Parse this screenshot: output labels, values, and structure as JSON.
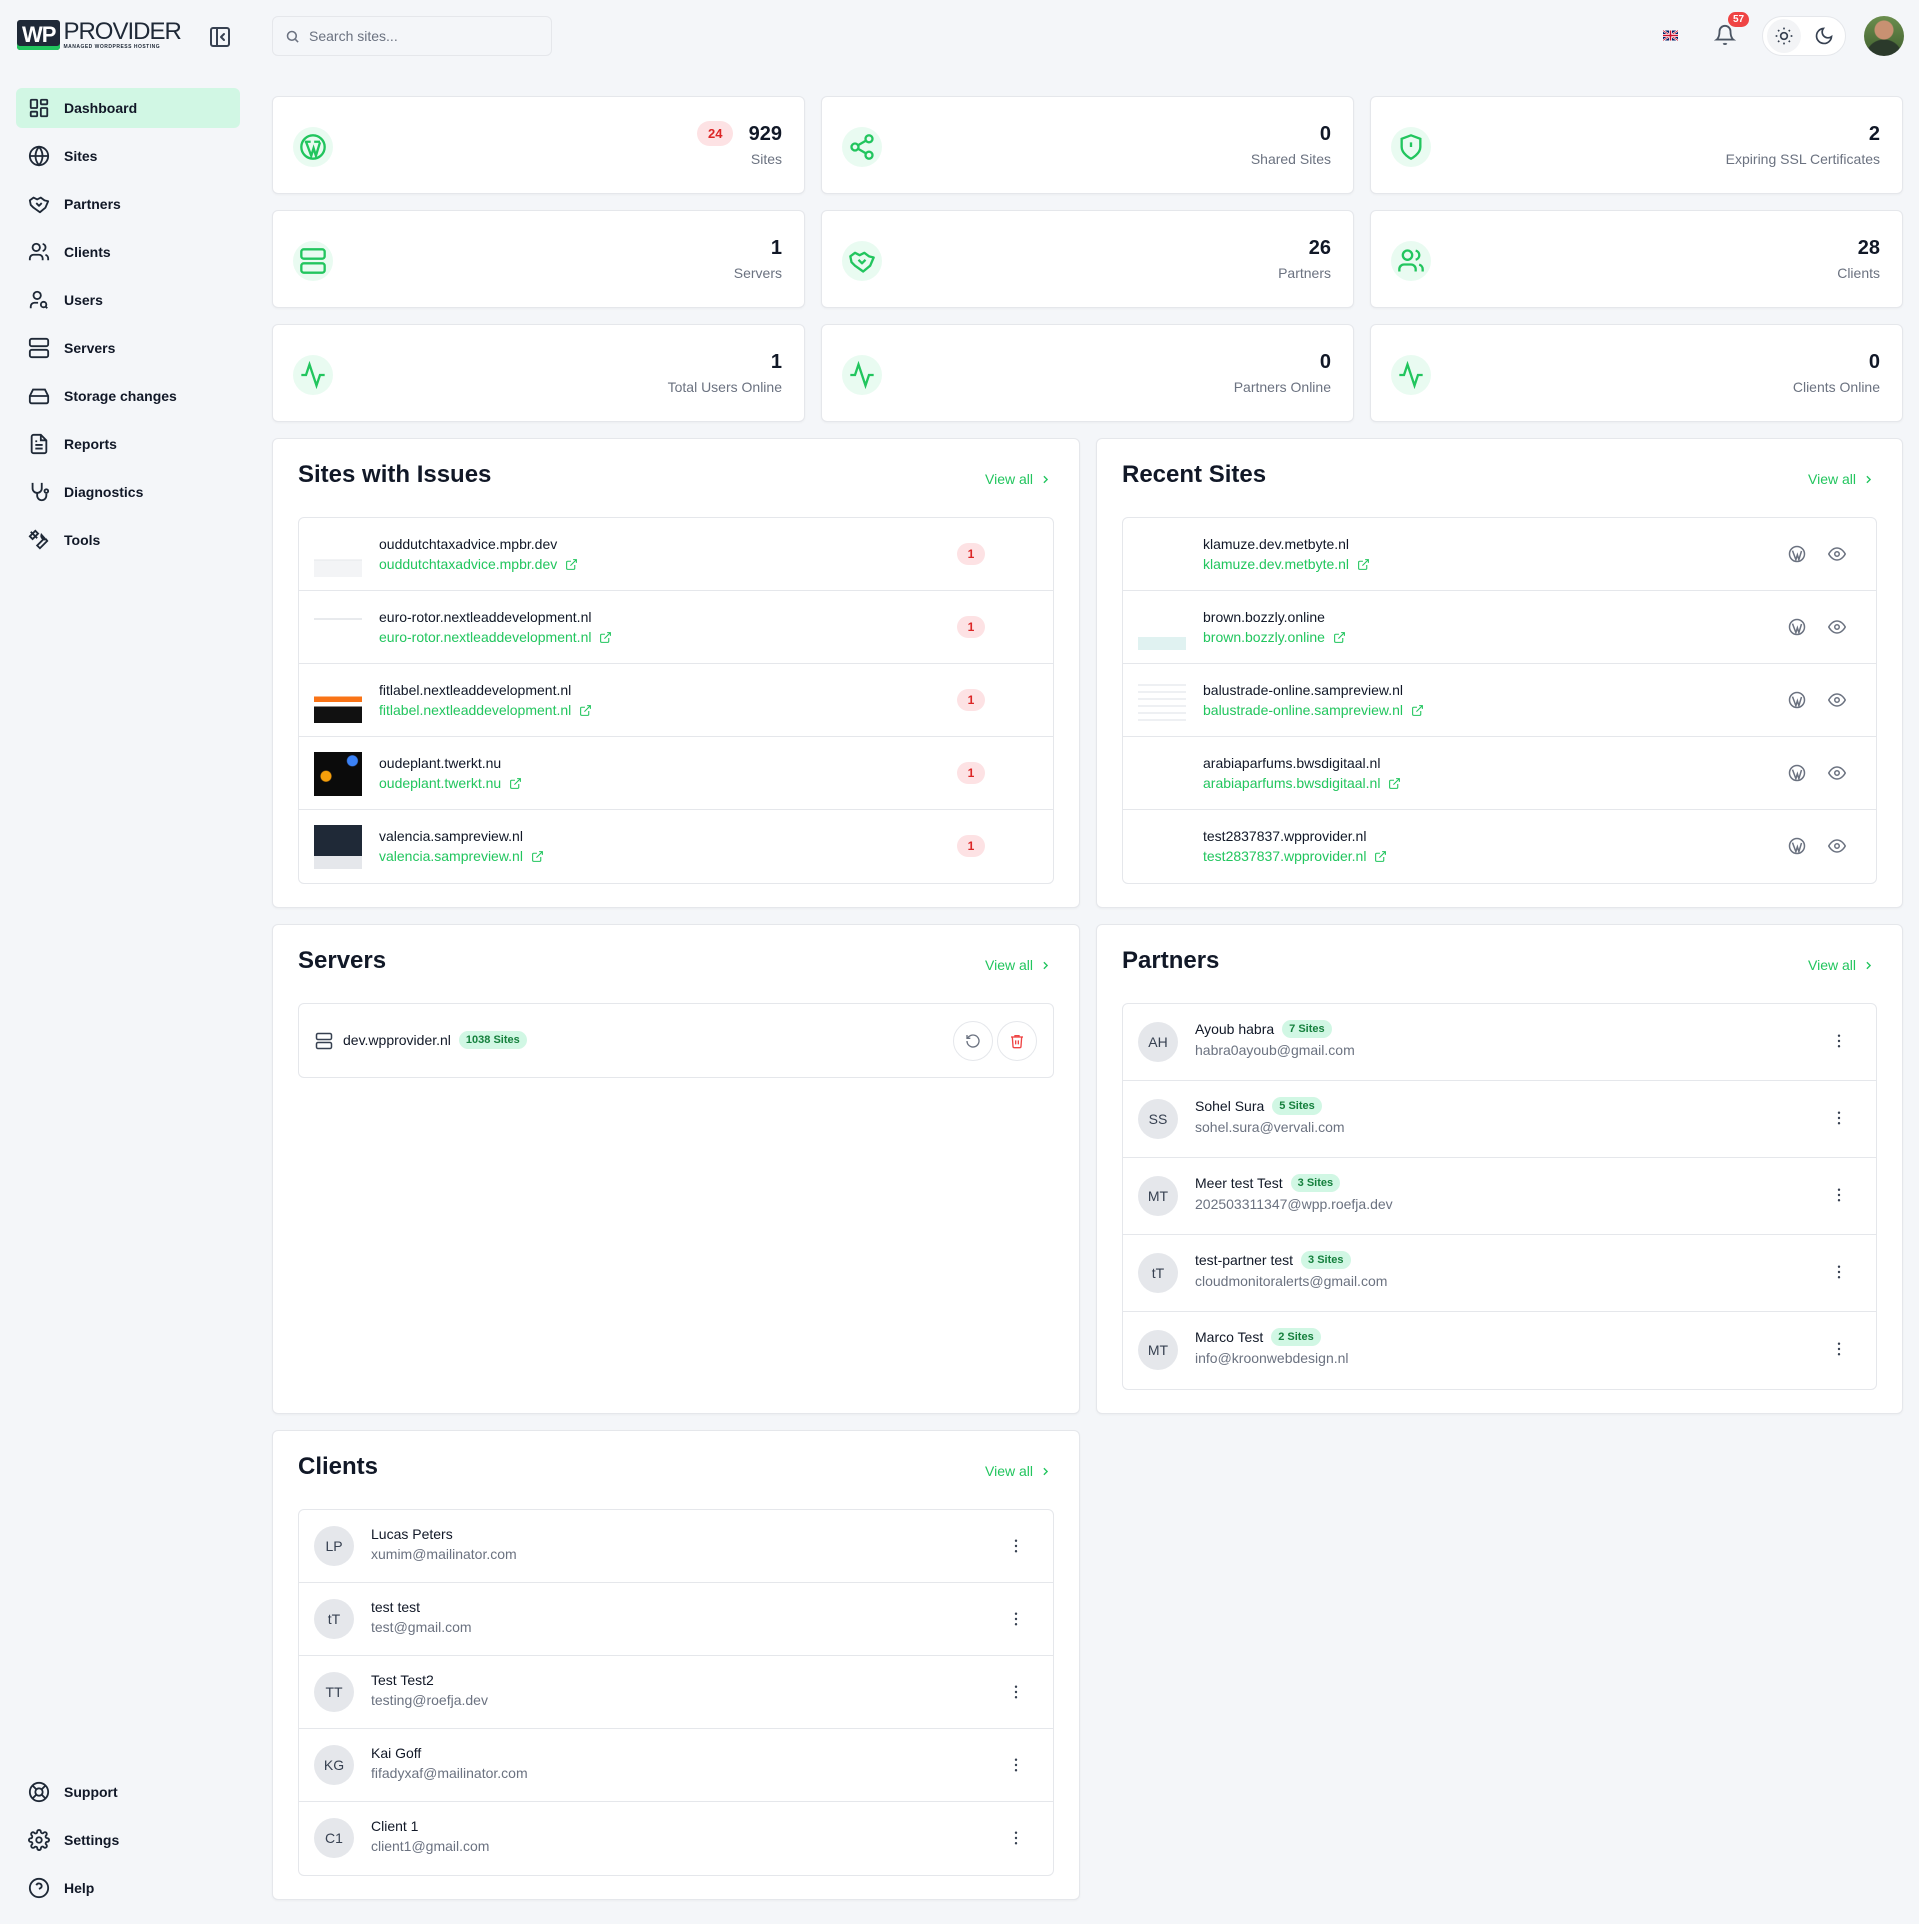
{
  "brand": {
    "logo_mark": "WP",
    "logo_name": "PROVIDER",
    "logo_sub": "MANAGED WORDPRESS HOSTING"
  },
  "search": {
    "placeholder": "Search sites..."
  },
  "notifications": {
    "count": "57"
  },
  "nav": {
    "items": [
      {
        "label": "Dashboard",
        "icon": "dashboard-icon",
        "active": true
      },
      {
        "label": "Sites",
        "icon": "globe-icon"
      },
      {
        "label": "Partners",
        "icon": "handshake-icon"
      },
      {
        "label": "Clients",
        "icon": "users-icon"
      },
      {
        "label": "Users",
        "icon": "user-search-icon"
      },
      {
        "label": "Servers",
        "icon": "server-icon"
      },
      {
        "label": "Storage changes",
        "icon": "hard-drive-icon"
      },
      {
        "label": "Reports",
        "icon": "report-icon"
      },
      {
        "label": "Diagnostics",
        "icon": "stethoscope-icon"
      },
      {
        "label": "Tools",
        "icon": "tools-icon"
      }
    ],
    "bottom": [
      {
        "label": "Support",
        "icon": "lifebuoy-icon"
      },
      {
        "label": "Settings",
        "icon": "gear-icon"
      },
      {
        "label": "Help",
        "icon": "help-icon"
      }
    ]
  },
  "stats": [
    {
      "value": "929",
      "label": "Sites",
      "badge": "24",
      "icon": "wordpress-icon"
    },
    {
      "value": "0",
      "label": "Shared Sites",
      "icon": "share-icon"
    },
    {
      "value": "2",
      "label": "Expiring SSL Certificates",
      "icon": "shield-alert-icon"
    },
    {
      "value": "1",
      "label": "Servers",
      "icon": "server-icon"
    },
    {
      "value": "26",
      "label": "Partners",
      "icon": "handshake-icon"
    },
    {
      "value": "28",
      "label": "Clients",
      "icon": "users-icon"
    },
    {
      "value": "1",
      "label": "Total Users Online",
      "icon": "activity-icon"
    },
    {
      "value": "0",
      "label": "Partners Online",
      "icon": "activity-icon"
    },
    {
      "value": "0",
      "label": "Clients Online",
      "icon": "activity-icon"
    }
  ],
  "view_all": "View all",
  "sites_with_issues": {
    "title": "Sites with Issues",
    "items": [
      {
        "name": "ouddutchtaxadvice.mpbr.dev",
        "url": "ouddutchtaxadvice.mpbr.dev",
        "issues": "1"
      },
      {
        "name": "euro-rotor.nextleaddevelopment.nl",
        "url": "euro-rotor.nextleaddevelopment.nl",
        "issues": "1"
      },
      {
        "name": "fitlabel.nextleaddevelopment.nl",
        "url": "fitlabel.nextleaddevelopment.nl",
        "issues": "1"
      },
      {
        "name": "oudeplant.twerkt.nu",
        "url": "oudeplant.twerkt.nu",
        "issues": "1"
      },
      {
        "name": "valencia.sampreview.nl",
        "url": "valencia.sampreview.nl",
        "issues": "1"
      }
    ]
  },
  "recent_sites": {
    "title": "Recent Sites",
    "items": [
      {
        "name": "klamuze.dev.metbyte.nl",
        "url": "klamuze.dev.metbyte.nl"
      },
      {
        "name": "brown.bozzly.online",
        "url": "brown.bozzly.online"
      },
      {
        "name": "balustrade-online.sampreview.nl",
        "url": "balustrade-online.sampreview.nl"
      },
      {
        "name": "arabiaparfums.bwsdigitaal.nl",
        "url": "arabiaparfums.bwsdigitaal.nl"
      },
      {
        "name": "test2837837.wpprovider.nl",
        "url": "test2837837.wpprovider.nl"
      }
    ]
  },
  "servers": {
    "title": "Servers",
    "items": [
      {
        "name": "dev.wpprovider.nl",
        "sites": "1038 Sites"
      }
    ]
  },
  "partners": {
    "title": "Partners",
    "items": [
      {
        "initials": "AH",
        "name": "Ayoub habra",
        "sites": "7 Sites",
        "email": "habra0ayoub@gmail.com"
      },
      {
        "initials": "SS",
        "name": "Sohel Sura",
        "sites": "5 Sites",
        "email": "sohel.sura@vervali.com"
      },
      {
        "initials": "MT",
        "name": "Meer test Test",
        "sites": "3 Sites",
        "email": "202503311347@wpp.roefja.dev"
      },
      {
        "initials": "tT",
        "name": "test-partner test",
        "sites": "3 Sites",
        "email": "cloudmonitoralerts@gmail.com"
      },
      {
        "initials": "MT",
        "name": "Marco Test",
        "sites": "2 Sites",
        "email": "info@kroonwebdesign.nl"
      }
    ]
  },
  "clients": {
    "title": "Clients",
    "items": [
      {
        "initials": "LP",
        "name": "Lucas Peters",
        "email": "xumim@mailinator.com"
      },
      {
        "initials": "tT",
        "name": "test test",
        "email": "test@gmail.com"
      },
      {
        "initials": "TT",
        "name": "Test Test2",
        "email": "testing@roefja.dev"
      },
      {
        "initials": "KG",
        "name": "Kai Goff",
        "email": "fifadyxaf@mailinator.com"
      },
      {
        "initials": "C1",
        "name": "Client 1",
        "email": "client1@gmail.com"
      }
    ]
  },
  "colors": {
    "accent": "#22c55e",
    "danger": "#dc2626",
    "active_bg": "#d1f7e4"
  }
}
